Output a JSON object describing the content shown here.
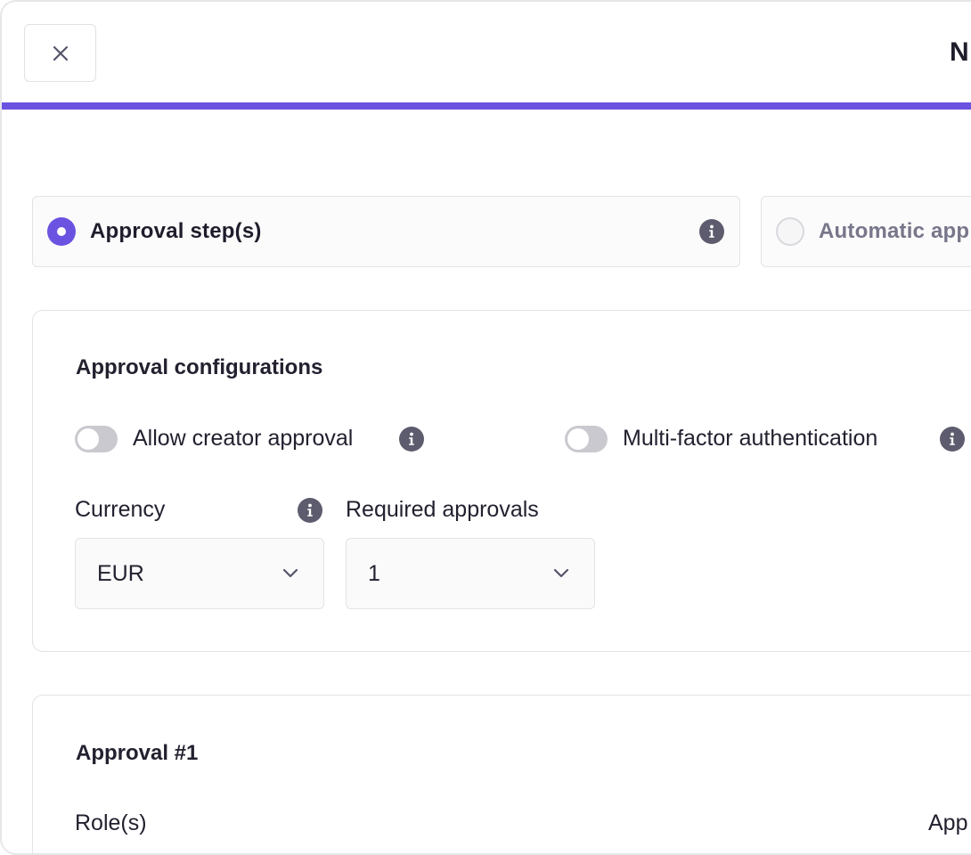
{
  "header": {
    "title": "N"
  },
  "approval_mode": {
    "options": [
      {
        "label": "Approval step(s)",
        "selected": true
      },
      {
        "label": "Automatic app",
        "selected": false
      }
    ]
  },
  "configurations": {
    "title": "Approval configurations",
    "toggles": [
      {
        "label": "Allow creator approval",
        "on": false
      },
      {
        "label": "Multi-factor authentication",
        "on": false
      }
    ],
    "currency": {
      "label": "Currency",
      "value": "EUR"
    },
    "required_approvals": {
      "label": "Required approvals",
      "value": "1"
    }
  },
  "approval_step": {
    "title": "Approval #1",
    "roles_label": "Role(s)",
    "right_label": "App"
  },
  "colors": {
    "accent": "#6c52e0",
    "info_icon": "#5d5c6e",
    "toggle_off": "#c9c9cf"
  }
}
